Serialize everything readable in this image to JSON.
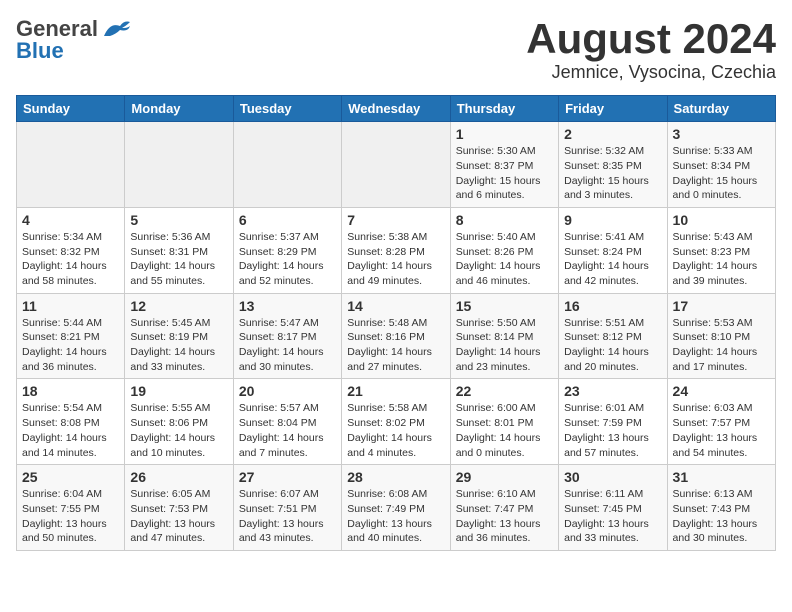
{
  "header": {
    "logo_general": "General",
    "logo_blue": "Blue",
    "main_title": "August 2024",
    "subtitle": "Jemnice, Vysocina, Czechia"
  },
  "calendar": {
    "days_of_week": [
      "Sunday",
      "Monday",
      "Tuesday",
      "Wednesday",
      "Thursday",
      "Friday",
      "Saturday"
    ],
    "weeks": [
      [
        {
          "day": "",
          "info": ""
        },
        {
          "day": "",
          "info": ""
        },
        {
          "day": "",
          "info": ""
        },
        {
          "day": "",
          "info": ""
        },
        {
          "day": "1",
          "info": "Sunrise: 5:30 AM\nSunset: 8:37 PM\nDaylight: 15 hours\nand 6 minutes."
        },
        {
          "day": "2",
          "info": "Sunrise: 5:32 AM\nSunset: 8:35 PM\nDaylight: 15 hours\nand 3 minutes."
        },
        {
          "day": "3",
          "info": "Sunrise: 5:33 AM\nSunset: 8:34 PM\nDaylight: 15 hours\nand 0 minutes."
        }
      ],
      [
        {
          "day": "4",
          "info": "Sunrise: 5:34 AM\nSunset: 8:32 PM\nDaylight: 14 hours\nand 58 minutes."
        },
        {
          "day": "5",
          "info": "Sunrise: 5:36 AM\nSunset: 8:31 PM\nDaylight: 14 hours\nand 55 minutes."
        },
        {
          "day": "6",
          "info": "Sunrise: 5:37 AM\nSunset: 8:29 PM\nDaylight: 14 hours\nand 52 minutes."
        },
        {
          "day": "7",
          "info": "Sunrise: 5:38 AM\nSunset: 8:28 PM\nDaylight: 14 hours\nand 49 minutes."
        },
        {
          "day": "8",
          "info": "Sunrise: 5:40 AM\nSunset: 8:26 PM\nDaylight: 14 hours\nand 46 minutes."
        },
        {
          "day": "9",
          "info": "Sunrise: 5:41 AM\nSunset: 8:24 PM\nDaylight: 14 hours\nand 42 minutes."
        },
        {
          "day": "10",
          "info": "Sunrise: 5:43 AM\nSunset: 8:23 PM\nDaylight: 14 hours\nand 39 minutes."
        }
      ],
      [
        {
          "day": "11",
          "info": "Sunrise: 5:44 AM\nSunset: 8:21 PM\nDaylight: 14 hours\nand 36 minutes."
        },
        {
          "day": "12",
          "info": "Sunrise: 5:45 AM\nSunset: 8:19 PM\nDaylight: 14 hours\nand 33 minutes."
        },
        {
          "day": "13",
          "info": "Sunrise: 5:47 AM\nSunset: 8:17 PM\nDaylight: 14 hours\nand 30 minutes."
        },
        {
          "day": "14",
          "info": "Sunrise: 5:48 AM\nSunset: 8:16 PM\nDaylight: 14 hours\nand 27 minutes."
        },
        {
          "day": "15",
          "info": "Sunrise: 5:50 AM\nSunset: 8:14 PM\nDaylight: 14 hours\nand 23 minutes."
        },
        {
          "day": "16",
          "info": "Sunrise: 5:51 AM\nSunset: 8:12 PM\nDaylight: 14 hours\nand 20 minutes."
        },
        {
          "day": "17",
          "info": "Sunrise: 5:53 AM\nSunset: 8:10 PM\nDaylight: 14 hours\nand 17 minutes."
        }
      ],
      [
        {
          "day": "18",
          "info": "Sunrise: 5:54 AM\nSunset: 8:08 PM\nDaylight: 14 hours\nand 14 minutes."
        },
        {
          "day": "19",
          "info": "Sunrise: 5:55 AM\nSunset: 8:06 PM\nDaylight: 14 hours\nand 10 minutes."
        },
        {
          "day": "20",
          "info": "Sunrise: 5:57 AM\nSunset: 8:04 PM\nDaylight: 14 hours\nand 7 minutes."
        },
        {
          "day": "21",
          "info": "Sunrise: 5:58 AM\nSunset: 8:02 PM\nDaylight: 14 hours\nand 4 minutes."
        },
        {
          "day": "22",
          "info": "Sunrise: 6:00 AM\nSunset: 8:01 PM\nDaylight: 14 hours\nand 0 minutes."
        },
        {
          "day": "23",
          "info": "Sunrise: 6:01 AM\nSunset: 7:59 PM\nDaylight: 13 hours\nand 57 minutes."
        },
        {
          "day": "24",
          "info": "Sunrise: 6:03 AM\nSunset: 7:57 PM\nDaylight: 13 hours\nand 54 minutes."
        }
      ],
      [
        {
          "day": "25",
          "info": "Sunrise: 6:04 AM\nSunset: 7:55 PM\nDaylight: 13 hours\nand 50 minutes."
        },
        {
          "day": "26",
          "info": "Sunrise: 6:05 AM\nSunset: 7:53 PM\nDaylight: 13 hours\nand 47 minutes."
        },
        {
          "day": "27",
          "info": "Sunrise: 6:07 AM\nSunset: 7:51 PM\nDaylight: 13 hours\nand 43 minutes."
        },
        {
          "day": "28",
          "info": "Sunrise: 6:08 AM\nSunset: 7:49 PM\nDaylight: 13 hours\nand 40 minutes."
        },
        {
          "day": "29",
          "info": "Sunrise: 6:10 AM\nSunset: 7:47 PM\nDaylight: 13 hours\nand 36 minutes."
        },
        {
          "day": "30",
          "info": "Sunrise: 6:11 AM\nSunset: 7:45 PM\nDaylight: 13 hours\nand 33 minutes."
        },
        {
          "day": "31",
          "info": "Sunrise: 6:13 AM\nSunset: 7:43 PM\nDaylight: 13 hours\nand 30 minutes."
        }
      ]
    ]
  }
}
